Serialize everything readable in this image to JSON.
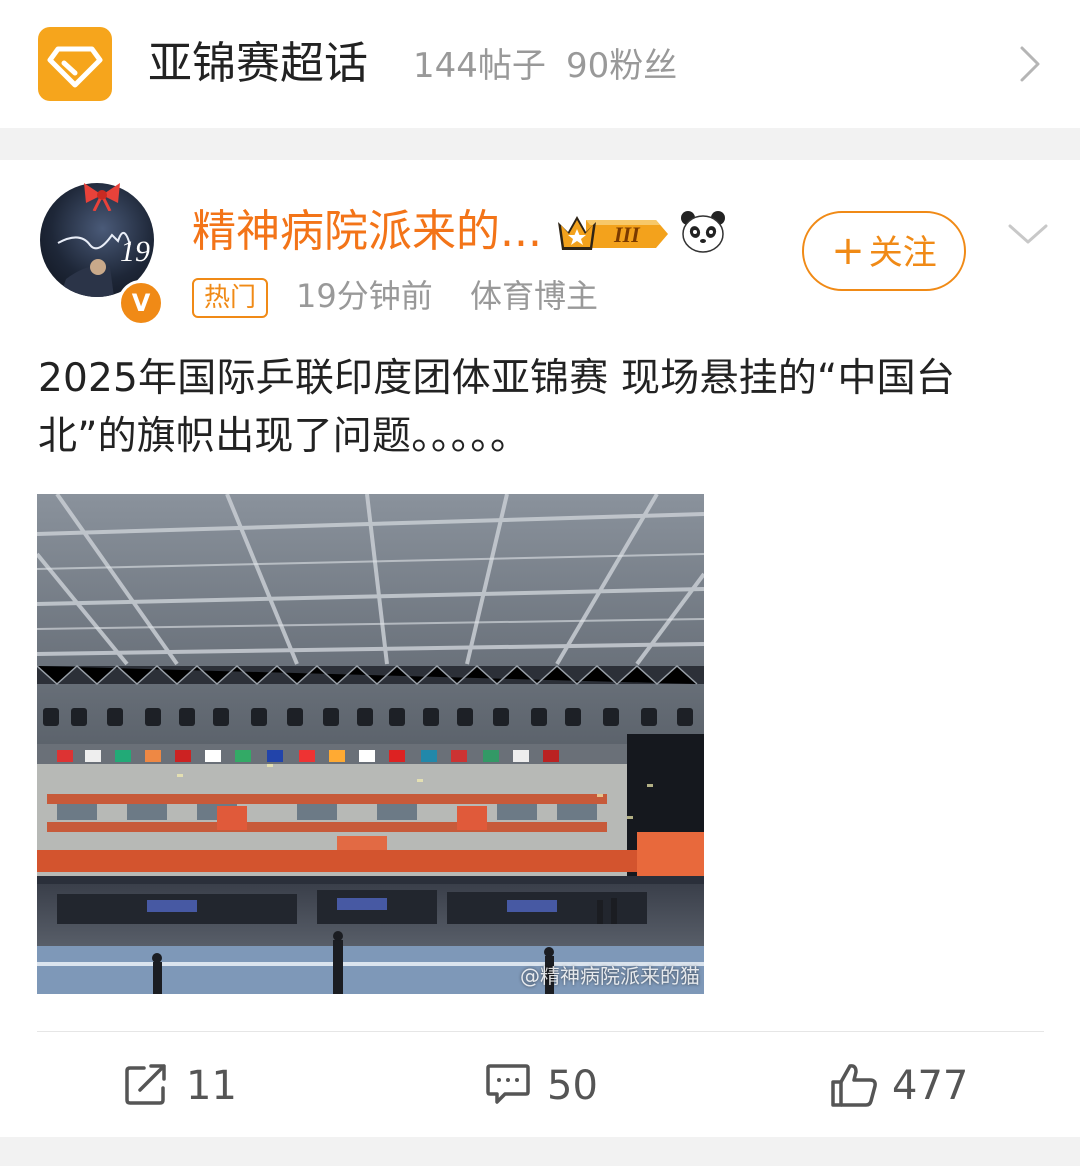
{
  "topic": {
    "title": "亚锦赛超话",
    "posts": "144帖子",
    "fans": "90粉丝",
    "logo_icon": "diamond-icon",
    "brand_color": "#f6a51c"
  },
  "post": {
    "author": {
      "name": "精神病院派来的...",
      "avatar_badge": "V",
      "member_level": "III",
      "accent_color": "#f37418"
    },
    "follow_label": "关注",
    "hot_tag": "热门",
    "time": "19分钟前",
    "source": "体育博主",
    "text": "2025年国际乒联印度团体亚锦赛 现场悬挂的“中国台北”的旗帜出现了问题。。。。。",
    "image": {
      "description_icon": "photo",
      "watermark": "@精神病院派来的猫"
    }
  },
  "actions": {
    "share_count": "11",
    "comment_count": "50",
    "like_count": "477"
  }
}
